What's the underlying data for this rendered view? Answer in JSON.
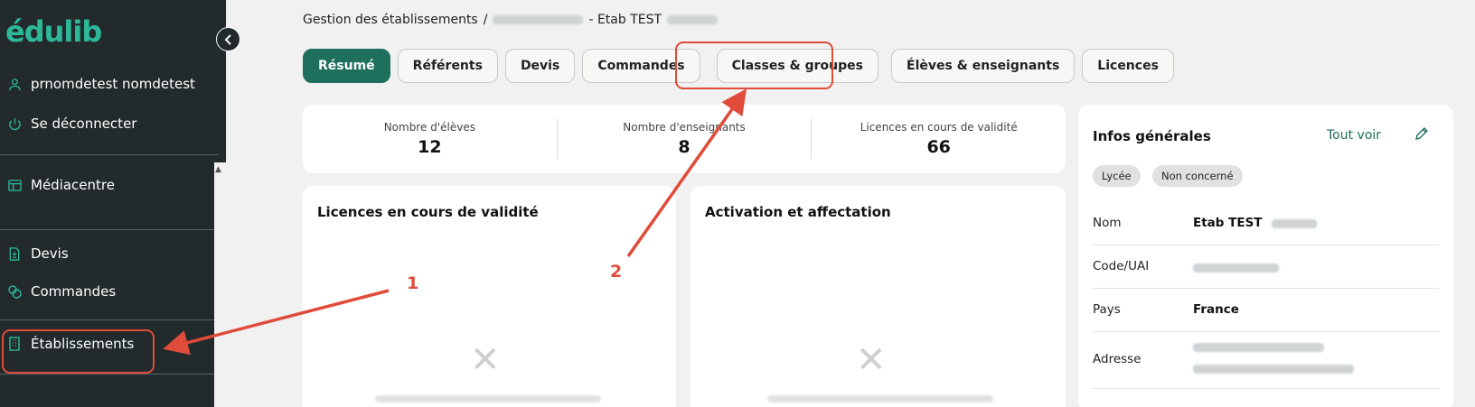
{
  "sidebar": {
    "logo": "édulib",
    "user_name": "prnomdetest nomdetest",
    "logout": "Se déconnecter",
    "items": [
      {
        "label": "Médiacentre"
      },
      {
        "label": "Devis"
      },
      {
        "label": "Commandes"
      },
      {
        "label": "Établissements"
      }
    ]
  },
  "breadcrumb": {
    "root": "Gestion des établissements",
    "separator": "/",
    "current_suffix": "- Etab TEST"
  },
  "tabs": [
    {
      "label": "Résumé",
      "active": true
    },
    {
      "label": "Référents"
    },
    {
      "label": "Devis"
    },
    {
      "label": "Commandes"
    },
    {
      "label": "Classes & groupes"
    },
    {
      "label": "Élèves & enseignants"
    },
    {
      "label": "Licences"
    }
  ],
  "stats": [
    {
      "label": "Nombre d'élèves",
      "value": "12"
    },
    {
      "label": "Nombre d'enseignants",
      "value": "8"
    },
    {
      "label": "Licences en cours de validité",
      "value": "66"
    }
  ],
  "cards": {
    "licences_title": "Licences en cours de validité",
    "activation_title": "Activation et affectation"
  },
  "info": {
    "title": "Infos générales",
    "see_all": "Tout voir",
    "badges": [
      "Lycée",
      "Non concerné"
    ],
    "rows": [
      {
        "label": "Nom",
        "value": "Etab TEST"
      },
      {
        "label": "Code/UAI",
        "value": ""
      },
      {
        "label": "Pays",
        "value": "France"
      },
      {
        "label": "Adresse",
        "value": ""
      }
    ]
  },
  "annotations": {
    "one": "1",
    "two": "2"
  },
  "colors": {
    "brand": "#2db89a",
    "active_tab": "#1e6f5c",
    "sidebar_bg": "#222a2c",
    "annotation_red": "#e04b3a"
  }
}
